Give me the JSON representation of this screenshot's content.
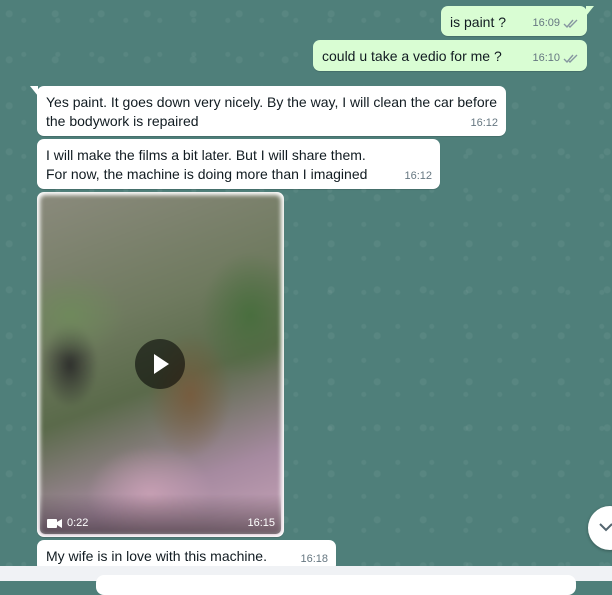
{
  "chat": {
    "messages": [
      {
        "direction": "out",
        "text": "is paint ?",
        "time": "16:09",
        "status": "read"
      },
      {
        "direction": "out",
        "text": "could u take a vedio for me ?",
        "time": "16:10",
        "status": "read"
      },
      {
        "direction": "in",
        "text": "Yes paint. It goes down very nicely. By the way, I will clean the car before\nthe bodywork is repaired",
        "time": "16:12"
      },
      {
        "direction": "in",
        "text": "I will make the films a bit later. But I will share them.\nFor now, the machine is doing more than I imagined",
        "time": "16:12"
      },
      {
        "direction": "in",
        "type": "video",
        "duration": "0:22",
        "time": "16:15"
      },
      {
        "direction": "in",
        "text": "My wife is in love with this machine.",
        "time": "16:18"
      }
    ]
  },
  "colors": {
    "chat_background": "#4f7f7a",
    "outgoing_bubble": "#d9fdd3",
    "incoming_bubble": "#ffffff",
    "read_ticks": "#53bdeb",
    "meta_text": "#667781"
  },
  "icons": {
    "read_receipt": "double-check-icon",
    "video_badge": "video-camera-icon",
    "play": "play-icon",
    "scroll_down": "chevron-down-icon"
  }
}
